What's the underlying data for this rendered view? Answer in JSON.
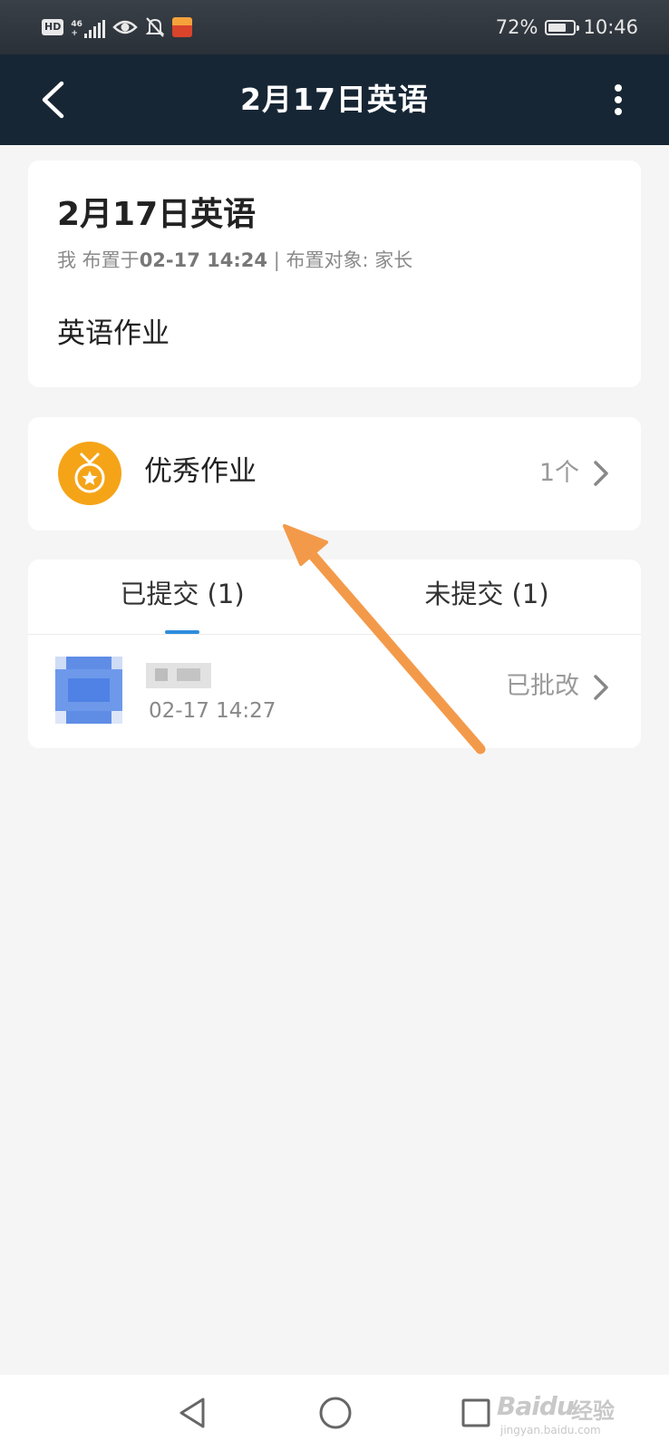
{
  "status_bar": {
    "hd": "HD",
    "network_top": "46",
    "network_bottom": "+",
    "battery_percent": "72%",
    "battery_level": 0.72,
    "time": "10:46"
  },
  "header": {
    "title": "2月17日英语"
  },
  "homework": {
    "title": "2月17日英语",
    "meta_prefix": "我 布置于",
    "meta_time": "02-17 14:24",
    "meta_suffix": " | 布置对象: 家长",
    "description": "英语作业"
  },
  "excellent": {
    "label": "优秀作业",
    "count": "1个"
  },
  "tabs": [
    {
      "label": "已提交 (1)",
      "active": true
    },
    {
      "label": "未提交 (1)",
      "active": false
    }
  ],
  "submissions": [
    {
      "time": "02-17 14:27",
      "status": "已批改"
    }
  ],
  "watermark": {
    "brand": "Bai",
    "brand2": "du",
    "cn": "经验",
    "url": "jingyan.baidu.com"
  },
  "colors": {
    "header_bg": "#172634",
    "accent": "#2e8ddd",
    "medal": "#f5a418",
    "arrow": "#f39a4a"
  }
}
